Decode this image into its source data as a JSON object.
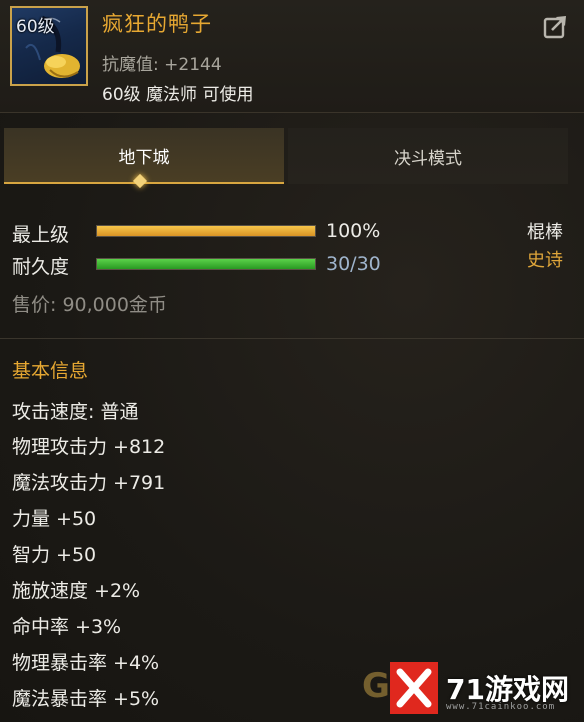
{
  "item": {
    "level_badge": "60级",
    "name": "疯狂的鸭子",
    "magic_resist": "抗魔值: +2144",
    "requirement": "60级 魔法师 可使用",
    "type": "棍棒",
    "rarity": "史诗",
    "rarity_color": "#e0a63a",
    "name_color": "#e7a832"
  },
  "tabs": [
    {
      "label": "地下城",
      "active": true
    },
    {
      "label": "决斗模式",
      "active": false
    }
  ],
  "bars": {
    "upgrade": {
      "label": "最上级",
      "value_text": "100%",
      "fraction": 1.0
    },
    "durability": {
      "label": "耐久度",
      "value_text": "30/30",
      "fraction": 1.0
    }
  },
  "price": "售价: 90,000金币",
  "basic_info": {
    "title": "基本信息",
    "stats": [
      "攻击速度: 普通",
      "物理攻击力 +812",
      "魔法攻击力 +791",
      "力量 +50",
      "智力 +50",
      "施放速度 +2%",
      "命中率 +3%",
      "物理暴击率 +4%",
      "魔法暴击率 +5%"
    ]
  },
  "icons": {
    "share": "share-icon",
    "item": "item-duck-icon"
  },
  "watermark": {
    "text": "71游戏网",
    "sub": "www.71cainkoo.com"
  }
}
